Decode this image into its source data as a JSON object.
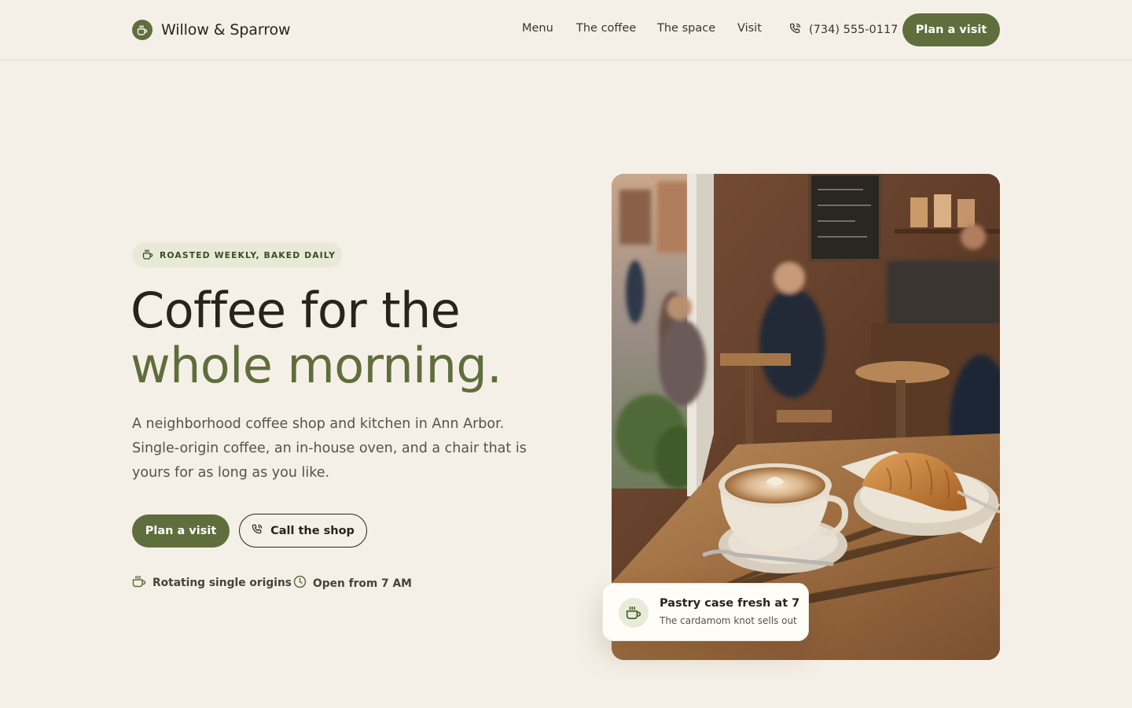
{
  "header": {
    "brand_name": "Willow & Sparrow",
    "brand_icon": "coffee-cup-icon",
    "nav": [
      {
        "label": "Menu"
      },
      {
        "label": "The coffee"
      },
      {
        "label": "The space"
      },
      {
        "label": "Visit"
      }
    ],
    "phone": "(734) 555-0117",
    "phone_icon": "phone-icon",
    "cta_label": "Plan a visit"
  },
  "hero": {
    "eyebrow": "ROASTED WEEKLY, BAKED DAILY",
    "eyebrow_icon": "coffee-cup-icon",
    "headline_line1": "Coffee for the",
    "headline_line2": "whole morning.",
    "lede": "A neighborhood coffee shop and kitchen in Ann Arbor. Single-origin coffee, an in-house oven, and a chair that is yours for as long as you like.",
    "primary_cta": "Plan a visit",
    "secondary_cta": "Call the shop",
    "secondary_cta_icon": "phone-icon",
    "features": [
      {
        "icon": "coffee-cup-icon",
        "label": "Rotating single origins"
      },
      {
        "icon": "clock-icon",
        "label": "Open from 7 AM"
      }
    ],
    "image_icon": "cafe-photo",
    "card": {
      "icon": "coffee-cup-icon",
      "title": "Pastry case fresh at 7",
      "subtitle": "The cardamom knot sells out"
    }
  },
  "colors": {
    "background": "#f5f0e7",
    "accent": "#5e6e3c",
    "text": "#2a231c",
    "eyebrow_bg": "#e7ead6"
  }
}
